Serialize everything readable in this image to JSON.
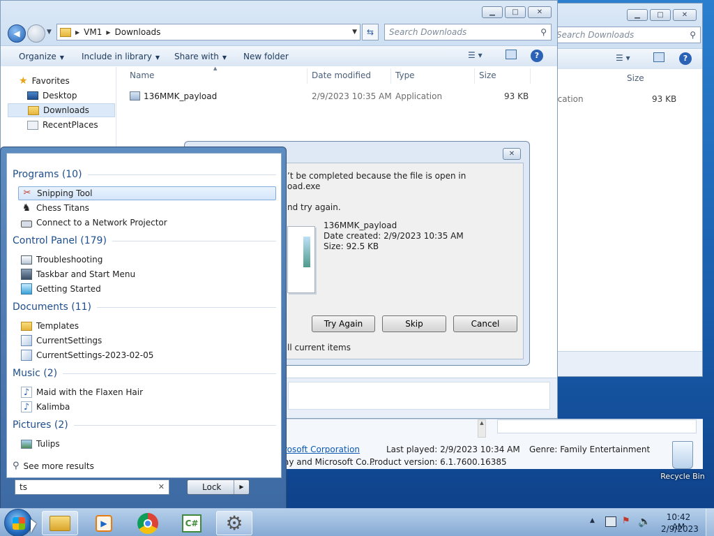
{
  "explorer_back": {
    "search_placeholder": "Search Downloads",
    "columns": {
      "size": "Size"
    },
    "row": {
      "type_partial": "lication",
      "size": "93 KB"
    }
  },
  "explorer": {
    "breadcrumb": [
      "VM1",
      "Downloads"
    ],
    "search_placeholder": "Search Downloads",
    "toolbar": {
      "organize": "Organize",
      "include": "Include in library",
      "share": "Share with",
      "new_folder": "New folder"
    },
    "nav": {
      "favorites": "Favorites",
      "desktop": "Desktop",
      "downloads": "Downloads",
      "recent": "RecentPlaces"
    },
    "columns": {
      "name": "Name",
      "date": "Date modified",
      "type": "Type",
      "size": "Size"
    },
    "row": {
      "name": "136MMK_payload",
      "date": "2/9/2023 10:35 AM",
      "type": "Application",
      "size": "93 KB"
    }
  },
  "dialog": {
    "msg_line1": "’t be completed because the file is open in",
    "msg_line2": "oad.exe",
    "msg_line3": "nd try again.",
    "file_name": "136MMK_payload",
    "file_date": "Date created: 2/9/2023 10:35 AM",
    "file_size": "Size: 92.5 KB",
    "btn_try": "Try Again",
    "btn_skip": "Skip",
    "btn_cancel": "Cancel",
    "check_label": "ll current items"
  },
  "start_menu": {
    "programs": {
      "title": "Programs (10)",
      "items": [
        "Snipping Tool",
        "Chess Titans",
        "Connect to a Network Projector"
      ]
    },
    "control_panel": {
      "title": "Control Panel (179)",
      "items": [
        "Troubleshooting",
        "Taskbar and Start Menu",
        "Getting Started"
      ]
    },
    "documents": {
      "title": "Documents (11)",
      "items": [
        "Templates",
        "CurrentSettings",
        "CurrentSettings-2023-02-05"
      ]
    },
    "music": {
      "title": "Music (2)",
      "items": [
        "Maid with the Flaxen Hair",
        "Kalimba"
      ]
    },
    "pictures": {
      "title": "Pictures (2)",
      "items": [
        "Tulips"
      ]
    },
    "see_more": "See more results",
    "search_value": "ts",
    "lock_label": "Lock"
  },
  "media_info": {
    "publisher": "rosoft Corporation",
    "publisher2": "ay and Microsoft Co...",
    "last_played": "Last played: 2/9/2023 10:34 AM",
    "genre": "Genre: Family Entertainment",
    "product_version": "Product version: 6.1.7600.16385"
  },
  "desktop": {
    "recycle_bin": "Recycle Bin"
  },
  "clock": {
    "time": "10:42 AM",
    "date": "2/9/2023"
  },
  "colors": {
    "accent": "#1e4e8c",
    "link": "#0b59b3"
  }
}
